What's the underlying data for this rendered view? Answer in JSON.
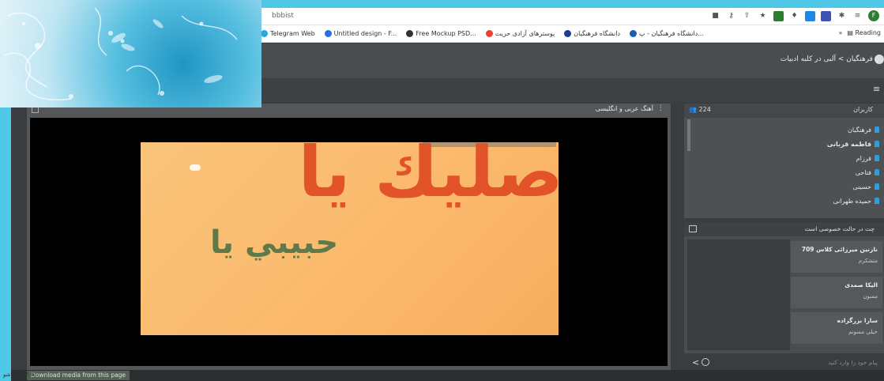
{
  "browser": {
    "url": "bbbist",
    "bookmarks": [
      {
        "label": "Telegram Web",
        "color": "#29a8e0"
      },
      {
        "label": "Untitled design - F...",
        "color": "#2a6fdb"
      },
      {
        "label": "Free Mockup PSD...",
        "color": "#333333"
      },
      {
        "label": "پوسترهای آزادی حریت",
        "color": "#ea4335"
      },
      {
        "label": "دانشگاه فرهنگیان",
        "color": "#1a3f8f"
      },
      {
        "label": "دانشگاه فرهنگیان - پ...",
        "color": "#1a5fb4"
      }
    ],
    "bookmarks_more": "»",
    "reading_list": "Reading",
    "profile_initial": "F"
  },
  "app": {
    "breadcrumb": "فرهنگیان > آلبی در کلبه ادبیات"
  },
  "video": {
    "title": "آهنگ عربی و انگلیسی",
    "slide_text_large": "صليك يا",
    "slide_text_small": "حبيبي يا"
  },
  "users": {
    "title": "کاربران",
    "count": "224",
    "list": [
      {
        "name": "فرهنگیان",
        "bold": false
      },
      {
        "name": "فاطمه قربانی",
        "bold": true
      },
      {
        "name": "فرزام",
        "bold": false
      },
      {
        "name": "فتاحی",
        "bold": false
      },
      {
        "name": "حسینی",
        "bold": false
      },
      {
        "name": "حمیده طهرانی",
        "bold": false
      }
    ]
  },
  "chat": {
    "title": "چت در حالت خصوصی است",
    "messages": [
      {
        "name": "نازنین میرزائی کلاس 709",
        "body": "متشکرم"
      },
      {
        "name": "الیکا صمدی",
        "body": "ممنون"
      },
      {
        "name": "سارا بزرگزاده",
        "body": "خیلی ممنونم"
      }
    ],
    "placeholder": "پیام خود را وارد کنید"
  },
  "bottom": {
    "download_media": "Download media from this page",
    "watermark": "اسکرین‌شو ©"
  },
  "colors": {
    "accent": "#2e9de0",
    "slide_red": "#e2532a",
    "slide_green": "#5f7a4a"
  }
}
